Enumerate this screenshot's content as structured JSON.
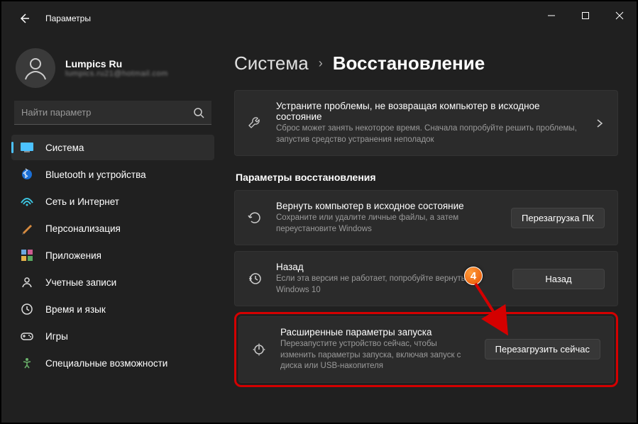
{
  "window": {
    "title": "Параметры"
  },
  "profile": {
    "name": "Lumpics Ru",
    "email": "lumpics.ru21@hotmail.com"
  },
  "search": {
    "placeholder": "Найти параметр"
  },
  "sidebar": {
    "items": [
      {
        "label": "Система",
        "icon": "system"
      },
      {
        "label": "Bluetooth и устройства",
        "icon": "bluetooth"
      },
      {
        "label": "Сеть и Интернет",
        "icon": "network"
      },
      {
        "label": "Персонализация",
        "icon": "personalization"
      },
      {
        "label": "Приложения",
        "icon": "apps"
      },
      {
        "label": "Учетные записи",
        "icon": "accounts"
      },
      {
        "label": "Время и язык",
        "icon": "time"
      },
      {
        "label": "Игры",
        "icon": "gaming"
      },
      {
        "label": "Специальные возможности",
        "icon": "accessibility"
      }
    ],
    "selected_index": 0
  },
  "breadcrumb": {
    "parent": "Система",
    "current": "Восстановление"
  },
  "troubleshoot_card": {
    "title": "Устраните проблемы, не возвращая компьютер в исходное состояние",
    "desc": "Сброс может занять некоторое время. Сначала попробуйте решить проблемы, запустив средство устранения неполадок"
  },
  "section_heading": "Параметры восстановления",
  "cards": [
    {
      "title": "Вернуть компьютер в исходное состояние",
      "desc": "Сохраните или удалите личные файлы, а затем переустановите Windows",
      "button": "Перезагрузка ПК"
    },
    {
      "title": "Назад",
      "desc": "Если эта версия не работает, попробуйте вернуться к Windows 10",
      "button": "Назад"
    },
    {
      "title": "Расширенные параметры запуска",
      "desc": "Перезапустите устройство сейчас, чтобы изменить параметры запуска, включая запуск с диска или USB-накопителя",
      "button": "Перезагрузить сейчас"
    }
  ],
  "annotation": {
    "number": "4"
  }
}
